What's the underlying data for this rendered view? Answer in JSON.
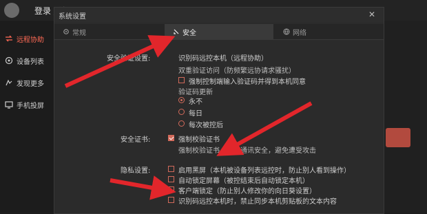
{
  "app": {
    "title": "登录 / 注册",
    "sidebar": [
      {
        "label": "远程协助",
        "icon": "remote-assist-icon",
        "active": true
      },
      {
        "label": "设备列表",
        "icon": "device-list-icon",
        "active": false
      },
      {
        "label": "发现更多",
        "icon": "discover-icon",
        "active": false
      },
      {
        "label": "手机投屏",
        "icon": "screen-cast-icon",
        "active": false
      }
    ]
  },
  "dialog": {
    "title": "系统设置",
    "close_glyph": "✕",
    "tabs": [
      {
        "label": "常规",
        "icon": "gear-icon",
        "active": false
      },
      {
        "label": "安全",
        "icon": "shield-icon",
        "active": true
      },
      {
        "label": "网络",
        "icon": "globe-icon",
        "active": false
      }
    ],
    "security_section": {
      "label": "安全验证设置:",
      "options_title": "识别码远控本机（远程协助）",
      "two_factor": "双重验证访问（防频繁远协请求骚扰）",
      "force_confirm": {
        "label": "强制控制端输入验证码并得到本机同意",
        "checked": false
      },
      "code_update": "验证码更新",
      "radio_options": [
        {
          "label": "永不",
          "selected": true
        },
        {
          "label": "每日",
          "selected": false
        },
        {
          "label": "每次被控后",
          "selected": false
        }
      ]
    },
    "cert_section": {
      "label": "安全证书:",
      "force_verify": {
        "label": "强制校验证书",
        "checked": true
      },
      "desc": "强制校验证书，加密通讯安全，避免遭受攻击"
    },
    "privacy_section": {
      "label": "隐私设置:",
      "options": [
        {
          "label": "启用黑屏（本机被设备列表远控时，防止别人看到操作）",
          "checked": false
        },
        {
          "label": "自动锁定屏幕（被控结束后自动锁定本机）",
          "checked": false
        },
        {
          "label": "客户端锁定（防止别人修改你的向日葵设置）",
          "checked": false
        },
        {
          "label": "识别码远控本机时，禁止同步本机剪贴板的文本内容",
          "checked": false
        }
      ]
    }
  },
  "colors": {
    "accent": "#d26a5a",
    "arrow": "#e2262b",
    "dialog_bg": "#2b2b2b",
    "active_tab": "#3a3a3a"
  }
}
